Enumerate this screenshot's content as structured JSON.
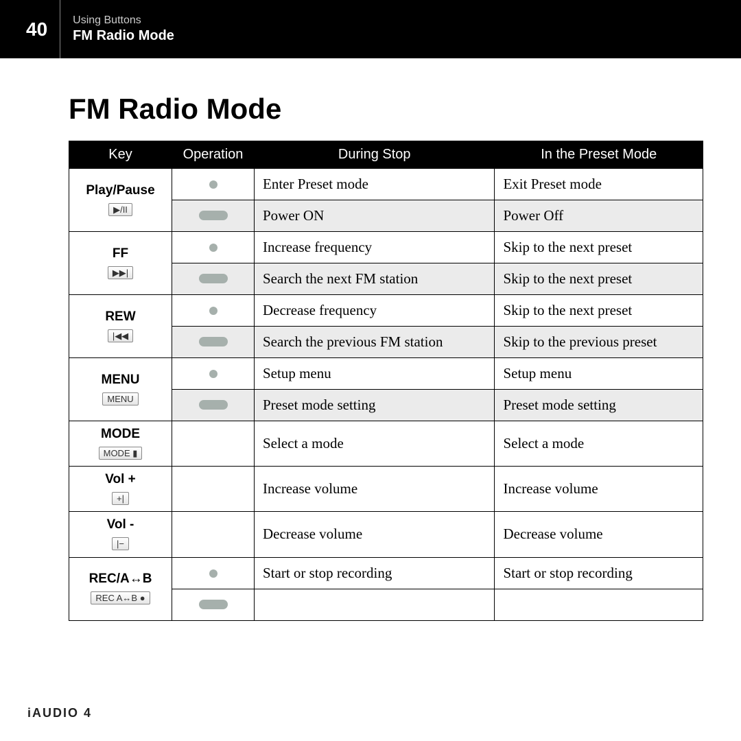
{
  "header": {
    "page_number": "40",
    "subtitle": "Using Buttons",
    "title": "FM Radio Mode"
  },
  "section_title": "FM Radio Mode",
  "footer": "iAUDIO 4",
  "columns": [
    "Key",
    "Operation",
    "During Stop",
    "In the Preset Mode"
  ],
  "rows": [
    {
      "key": "Play/Pause",
      "icon": "▶/II",
      "op1": "dot",
      "stop1": "Enter Preset mode",
      "preset1": "Exit Preset mode",
      "op2": "pill",
      "stop2": "Power ON",
      "preset2": "Power Off",
      "grey2": true
    },
    {
      "key": "FF",
      "icon": "▶▶|",
      "op1": "dot",
      "stop1": "Increase frequency",
      "preset1": "Skip to the next preset",
      "op2": "pill",
      "stop2": "Search the next FM station",
      "preset2": "Skip to the next preset",
      "grey2": true
    },
    {
      "key": "REW",
      "icon": "|◀◀",
      "op1": "dot",
      "stop1": "Decrease frequency",
      "preset1": "Skip to the next preset",
      "op2": "pill",
      "stop2": "Search the previous FM station",
      "preset2": "Skip to the previous preset",
      "grey2": true
    },
    {
      "key": "MENU",
      "icon": "MENU",
      "op1": "dot",
      "stop1": "Setup menu",
      "preset1": "Setup menu",
      "op2": "pill",
      "stop2": "Preset mode setting",
      "preset2": "Preset mode setting",
      "grey2": true
    },
    {
      "key": "MODE",
      "icon": "MODE ▮",
      "single": true,
      "stop1": "Select a mode",
      "preset1": "Select a mode"
    },
    {
      "key": "Vol +",
      "icon": "+|",
      "single": true,
      "stop1": "Increase volume",
      "preset1": "Increase volume"
    },
    {
      "key": "Vol -",
      "icon": "|−",
      "single": true,
      "stop1": "Decrease volume",
      "preset1": "Decrease volume"
    },
    {
      "key": "REC/A↔B",
      "icon": "REC A↔B ●",
      "op1": "dot",
      "stop1": "Start or stop recording",
      "preset1": "Start or stop recording",
      "op2": "pill",
      "stop2": "",
      "preset2": ""
    }
  ]
}
